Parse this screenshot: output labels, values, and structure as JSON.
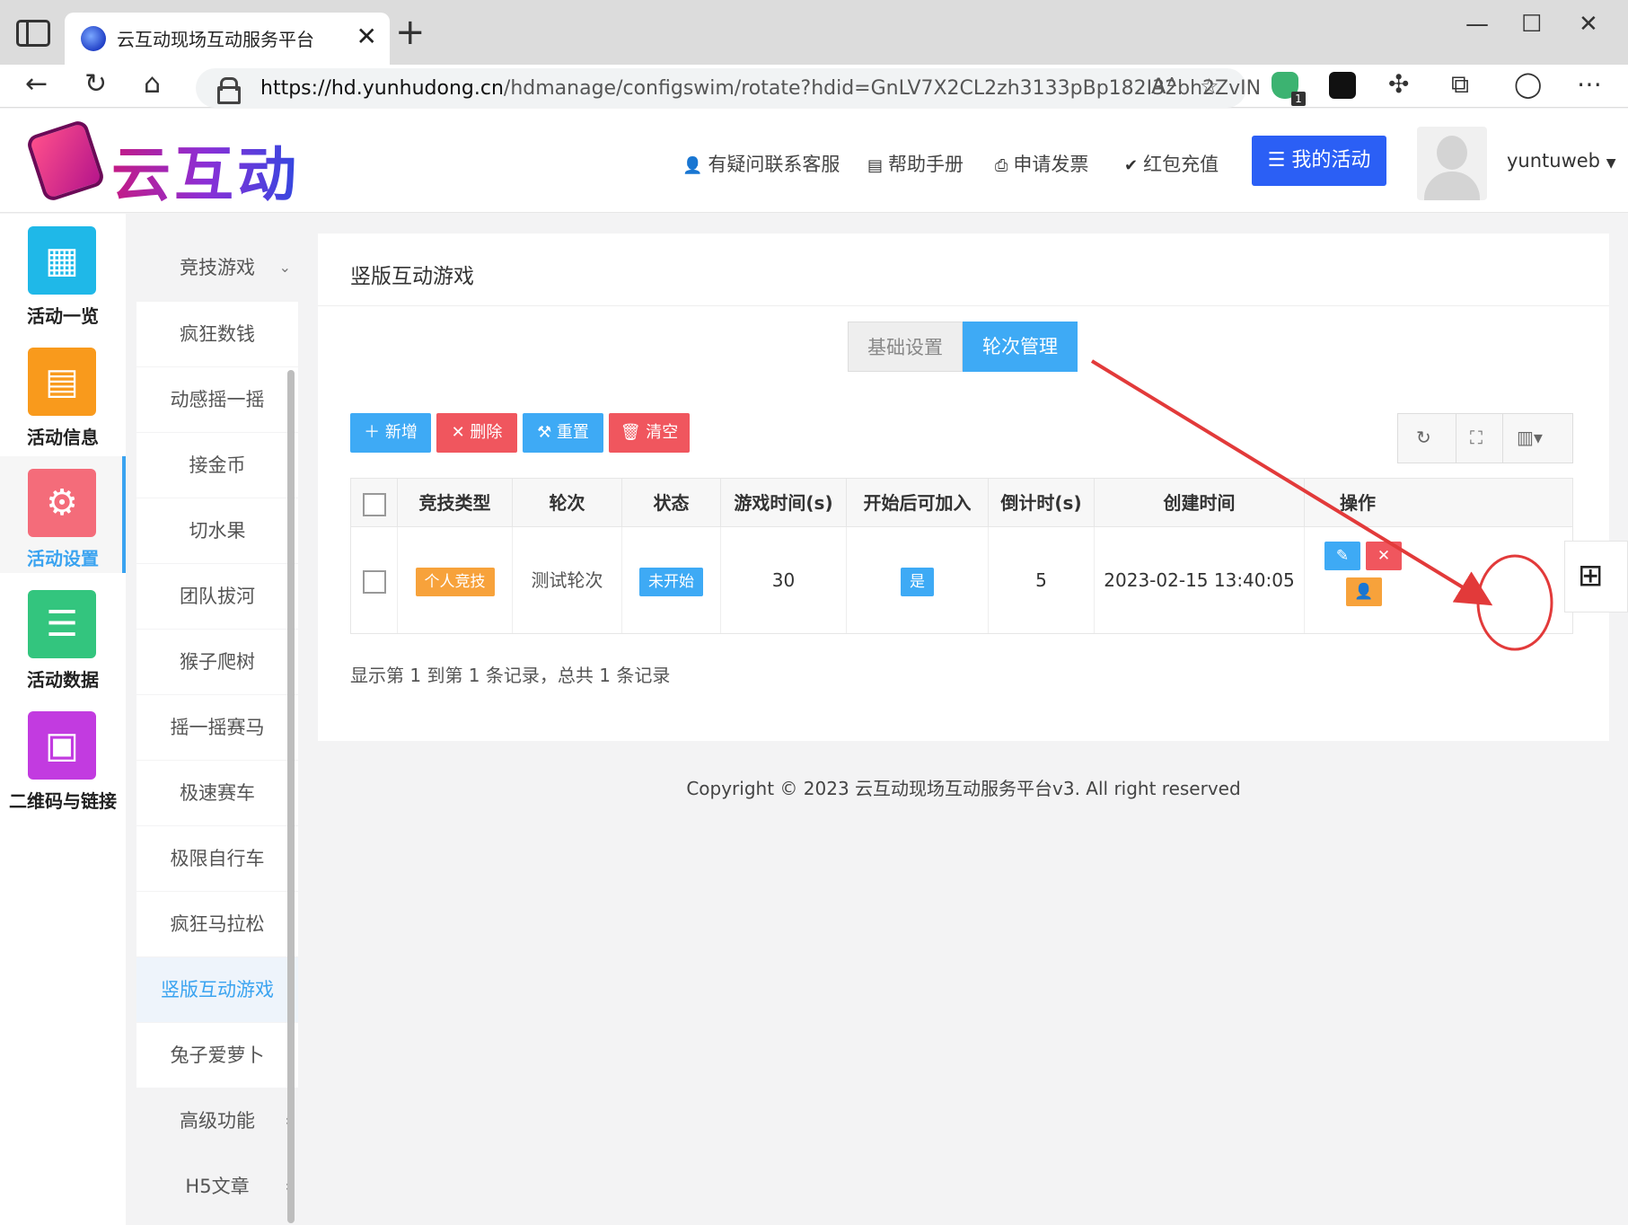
{
  "browser": {
    "tab_title": "云互动现场互动服务平台",
    "url_domain": "https://hd.yunhudong.cn",
    "url_path": "/hdmanage/configswim/rotate?hdid=GnLV7X2CL2zh3133pBp182I32bh2ZvIN",
    "ext_badge": "1"
  },
  "header": {
    "logo_text": "云互动",
    "links": [
      "有疑问联系客服",
      "帮助手册",
      "申请发票",
      "红包充值"
    ],
    "my_activity": "我的活动",
    "username": "yuntuweb"
  },
  "rail": {
    "items": [
      {
        "label": "活动一览",
        "icon": "grid-icon",
        "color": "#1fb8e8"
      },
      {
        "label": "活动信息",
        "icon": "document-icon",
        "color": "#f99a1c"
      },
      {
        "label": "活动设置",
        "icon": "gear-icon",
        "color": "#f46c7a"
      },
      {
        "label": "活动数据",
        "icon": "database-icon",
        "color": "#33c57e"
      },
      {
        "label": "二维码与链接",
        "icon": "qrcode-icon",
        "color": "#c23be0"
      }
    ]
  },
  "submenu": {
    "group_top": "竞技游戏",
    "items": [
      "疯狂数钱",
      "动感摇一摇",
      "接金币",
      "切水果",
      "团队拔河",
      "猴子爬树",
      "摇一摇赛马",
      "极速赛车",
      "极限自行车",
      "疯狂马拉松",
      "竖版互动游戏",
      "兔子爱萝卜"
    ],
    "active": "竖版互动游戏",
    "group_advanced": "高级功能",
    "group_h5": "H5文章"
  },
  "main": {
    "title": "竖版互动游戏",
    "tabs": [
      "基础设置",
      "轮次管理"
    ],
    "active_tab": "轮次管理",
    "toolbar": {
      "add": "新增",
      "delete": "删除",
      "reset": "重置",
      "clear": "清空"
    },
    "table": {
      "headers": [
        "竞技类型",
        "轮次",
        "状态",
        "游戏时间(s)",
        "开始后可加入",
        "倒计时(s)",
        "创建时间",
        "操作"
      ],
      "rows": [
        {
          "type": "个人竞技",
          "round": "测试轮次",
          "status": "未开始",
          "game_time": "30",
          "join_after_start": "是",
          "countdown": "5",
          "created": "2023-02-15 13:40:05"
        }
      ]
    },
    "pager": "显示第 1 到第 1 条记录，总共 1 条记录"
  },
  "footer": {
    "copyright": "Copyright © 2023 云互动现场互动服务平台v3. All right reserved"
  },
  "colors": {
    "accent": "#3eaaf5",
    "primary_btn": "#2b5ff5",
    "danger": "#f0565e",
    "warning": "#f7a23b",
    "annotation": "#e23a3a"
  }
}
